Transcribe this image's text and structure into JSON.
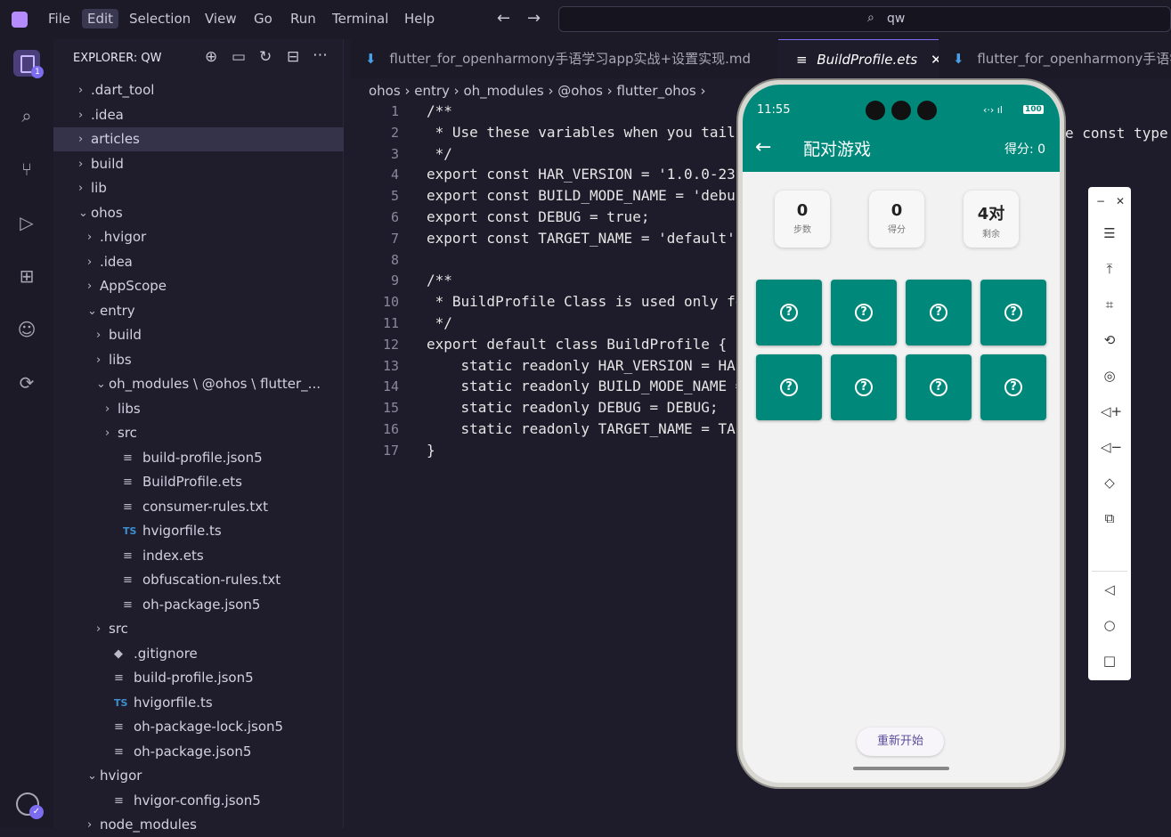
{
  "menu": [
    "File",
    "Edit",
    "Selection",
    "View",
    "Go",
    "Run",
    "Terminal",
    "Help"
  ],
  "active_menu": "Edit",
  "search": {
    "text": "qw"
  },
  "explorer": {
    "title": "EXPLORER: QW",
    "items": [
      {
        "label": ".dart_tool",
        "depth": 0,
        "type": "folder",
        "open": false
      },
      {
        "label": ".idea",
        "depth": 0,
        "type": "folder",
        "open": false
      },
      {
        "label": "articles",
        "depth": 0,
        "type": "folder",
        "open": false,
        "selected": true
      },
      {
        "label": "build",
        "depth": 0,
        "type": "folder",
        "open": false
      },
      {
        "label": "lib",
        "depth": 0,
        "type": "folder",
        "open": false
      },
      {
        "label": "ohos",
        "depth": 0,
        "type": "folder",
        "open": true
      },
      {
        "label": ".hvigor",
        "depth": 1,
        "type": "folder",
        "open": false
      },
      {
        "label": ".idea",
        "depth": 1,
        "type": "folder",
        "open": false
      },
      {
        "label": "AppScope",
        "depth": 1,
        "type": "folder",
        "open": false
      },
      {
        "label": "entry",
        "depth": 1,
        "type": "folder",
        "open": true
      },
      {
        "label": "build",
        "depth": 2,
        "type": "folder",
        "open": false
      },
      {
        "label": "libs",
        "depth": 2,
        "type": "folder",
        "open": false
      },
      {
        "label": "oh_modules \\ @ohos \\ flutter_...",
        "depth": 2,
        "type": "folder",
        "open": true
      },
      {
        "label": "libs",
        "depth": 3,
        "type": "folder",
        "open": false
      },
      {
        "label": "src",
        "depth": 3,
        "type": "folder",
        "open": false
      },
      {
        "label": "build-profile.json5",
        "depth": 3,
        "type": "file"
      },
      {
        "label": "BuildProfile.ets",
        "depth": 3,
        "type": "file"
      },
      {
        "label": "consumer-rules.txt",
        "depth": 3,
        "type": "file"
      },
      {
        "label": "hvigorfile.ts",
        "depth": 3,
        "type": "ts"
      },
      {
        "label": "index.ets",
        "depth": 3,
        "type": "file"
      },
      {
        "label": "obfuscation-rules.txt",
        "depth": 3,
        "type": "file"
      },
      {
        "label": "oh-package.json5",
        "depth": 3,
        "type": "file"
      },
      {
        "label": "src",
        "depth": 2,
        "type": "folder",
        "open": false
      },
      {
        "label": ".gitignore",
        "depth": 2,
        "type": "git"
      },
      {
        "label": "build-profile.json5",
        "depth": 2,
        "type": "file"
      },
      {
        "label": "hvigorfile.ts",
        "depth": 2,
        "type": "ts"
      },
      {
        "label": "oh-package-lock.json5",
        "depth": 2,
        "type": "file"
      },
      {
        "label": "oh-package.json5",
        "depth": 2,
        "type": "file"
      },
      {
        "label": "hvigor",
        "depth": 1,
        "type": "folder",
        "open": true
      },
      {
        "label": "hvigor-config.json5",
        "depth": 2,
        "type": "file"
      },
      {
        "label": "node_modules",
        "depth": 1,
        "type": "folder",
        "open": false
      }
    ]
  },
  "tabs": [
    {
      "label": "flutter_for_openharmony手语学习app实战+设置实现.md",
      "active": false
    },
    {
      "label": "BuildProfile.ets",
      "active": true
    },
    {
      "label": "flutter_for_openharmony手语学",
      "active": false
    }
  ],
  "breadcrumb": [
    "ohos",
    "entry",
    "oh_modules",
    "@ohos",
    "flutter_ohos"
  ],
  "code_lines": [
    "/**",
    " * Use these variables when you tail",
    " */",
    "export const HAR_VERSION = '1.0.0-23",
    "export const BUILD_MODE_NAME = 'debu",
    "export const DEBUG = true;",
    "export const TARGET_NAME = 'default'",
    "",
    "/**",
    " * BuildProfile Class is used only fo",
    " */",
    "export default class BuildProfile {",
    "    static readonly HAR_VERSION = HA",
    "    static readonly BUILD_MODE_NAME =",
    "    static readonly DEBUG = DEBUG;",
    "    static readonly TARGET_NAME = TA",
    "}"
  ],
  "line_numbers": [
    "1",
    "2",
    "3",
    "4",
    "5",
    "6",
    "7",
    "8",
    "9",
    "10",
    "11",
    "12",
    "13",
    "14",
    "15",
    "16",
    "17"
  ],
  "code_overflow_text": "e const type.",
  "phone": {
    "time": "11:55",
    "battery": "100",
    "app_title": "配对游戏",
    "score_label": "得分: 0",
    "stats": [
      {
        "value": "0",
        "label": "步数"
      },
      {
        "value": "0",
        "label": "得分"
      },
      {
        "value": "4对",
        "label": "剩余"
      }
    ],
    "card_symbol": "?",
    "card_count": 8,
    "restart": "重新开始"
  },
  "colors": {
    "accent": "#00897b",
    "purple": "#7c6cf0"
  }
}
